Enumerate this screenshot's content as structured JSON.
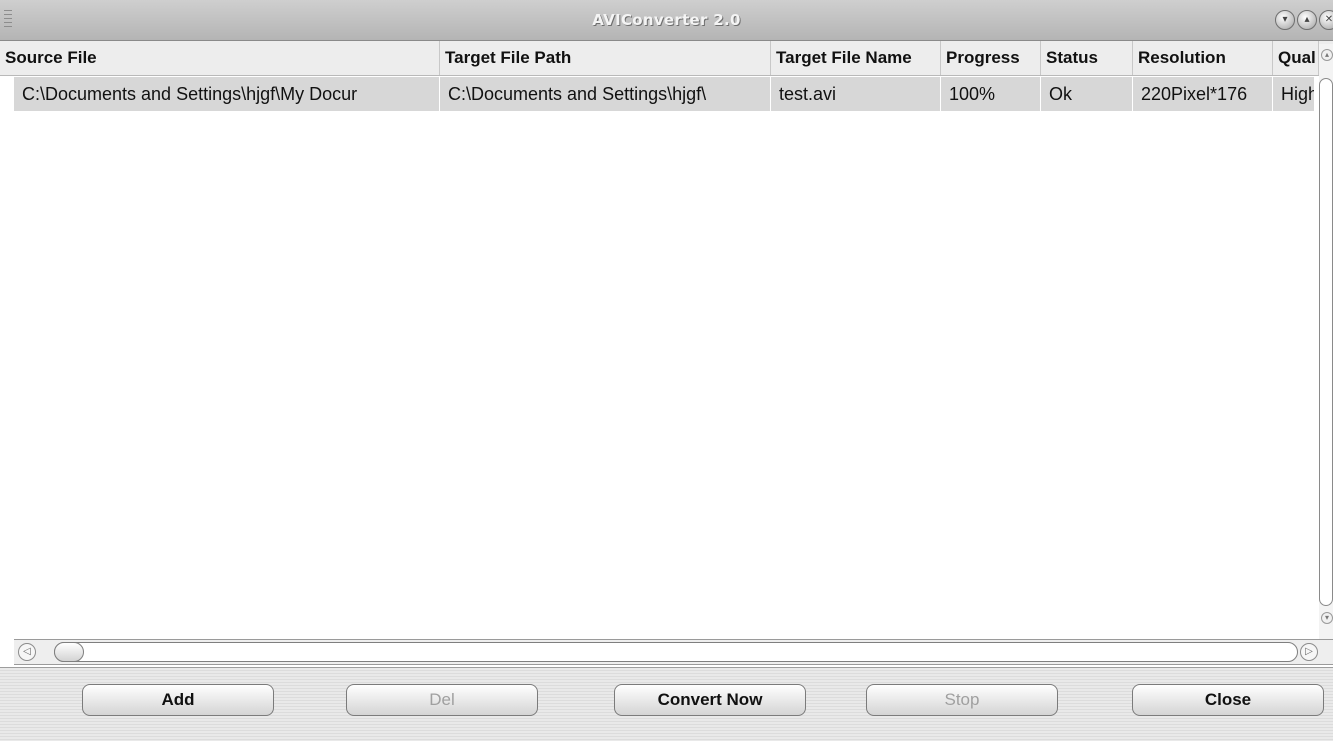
{
  "window": {
    "title": "AVIConverter 2.0"
  },
  "table": {
    "columns": [
      "Source File",
      "Target File Path",
      "Target File Name",
      "Progress",
      "Status",
      "Resolution",
      "Qual"
    ],
    "rows": [
      {
        "source_file": "C:\\Documents and Settings\\hjgf\\My Docur",
        "target_path": "C:\\Documents and Settings\\hjgf\\",
        "target_name": "test.avi",
        "progress": "100%",
        "status": "Ok",
        "resolution": "220Pixel*176",
        "quality": "High"
      }
    ]
  },
  "buttons": {
    "add": "Add",
    "del": "Del",
    "convert": "Convert Now",
    "stop": "Stop",
    "close": "Close"
  },
  "colors": {
    "title_text": "#f4f4f4",
    "selected_row": "#d7d7d7",
    "disabled_text": "#a0a0a0"
  }
}
